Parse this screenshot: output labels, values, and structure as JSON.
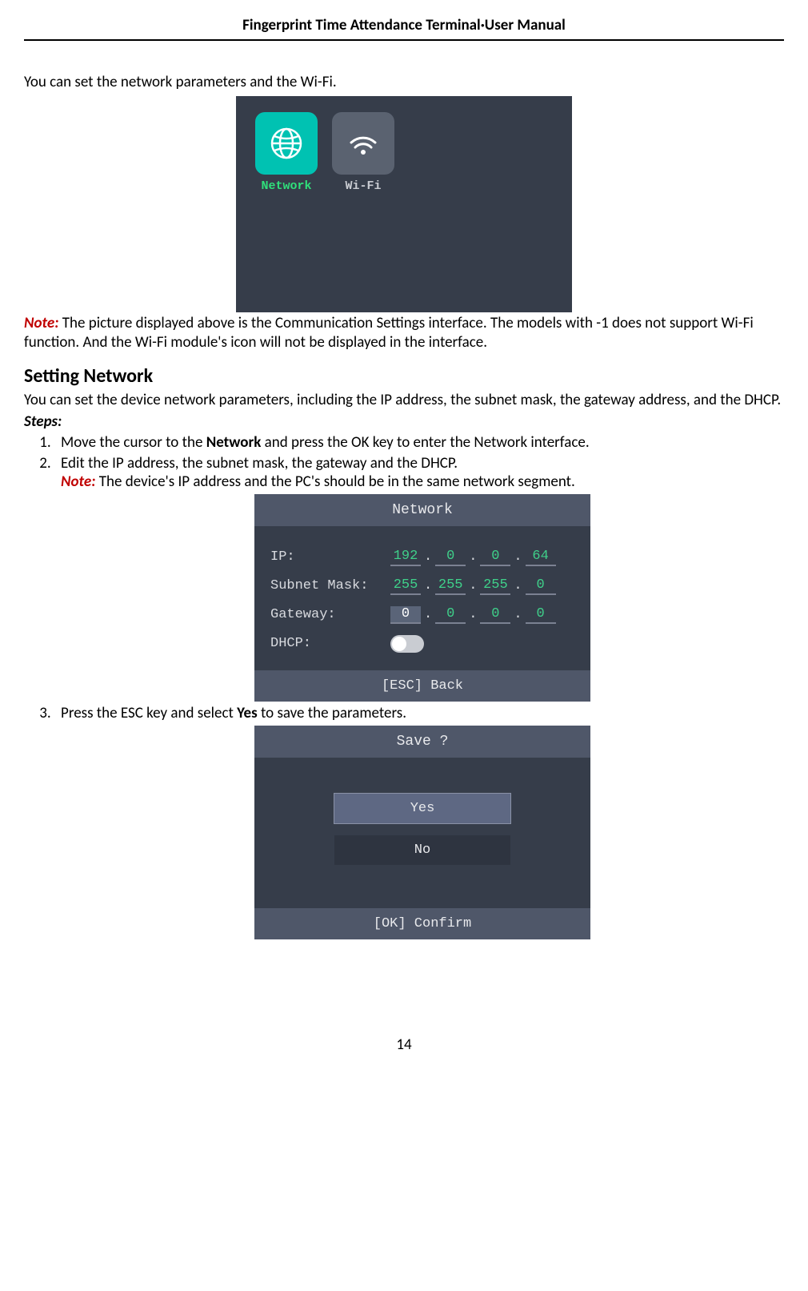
{
  "header": {
    "title": "Fingerprint Time Attendance Terminal·User Manual"
  },
  "page_number": "14",
  "intro": {
    "line1": "You can set the network parameters and the Wi-Fi."
  },
  "shot1": {
    "tiles": [
      {
        "label": "Network",
        "selected": true
      },
      {
        "label": "Wi-Fi",
        "selected": false
      }
    ]
  },
  "note1": {
    "label": "Note:",
    "text": " The picture displayed above is the Communication Settings interface. The models with -1 does not support Wi-Fi function. And the Wi-Fi module's icon will not be displayed in the interface."
  },
  "section": {
    "heading": "Setting Network",
    "intro": "You can set the device network parameters, including the IP address, the subnet mask, the gateway address, and the DHCP.",
    "steps_label": "Steps:",
    "steps": {
      "s1_a": "Move the cursor to the ",
      "s1_b": "Network",
      "s1_c": " and press the OK key to enter the Network interface.",
      "s2": "Edit the IP address, the subnet mask, the gateway and the DHCP.",
      "s2_note_label": "Note:",
      "s2_note_text": " The device's IP address and the PC's should be in the same network segment.",
      "s3_a": "Press the ESC key and select ",
      "s3_b": "Yes",
      "s3_c": " to save the parameters."
    }
  },
  "shot2": {
    "title": "Network",
    "footer": "[ESC] Back",
    "rows": {
      "ip_label": "IP:",
      "ip": [
        "192",
        "0",
        "0",
        "64"
      ],
      "mask_label": "Subnet Mask:",
      "mask": [
        "255",
        "255",
        "255",
        "0"
      ],
      "gw_label": "Gateway:",
      "gw": [
        "0",
        "0",
        "0",
        "0"
      ],
      "dhcp_label": "DHCP:"
    }
  },
  "shot3": {
    "title": "Save ?",
    "yes": "Yes",
    "no": "No",
    "footer": "[OK] Confirm"
  }
}
